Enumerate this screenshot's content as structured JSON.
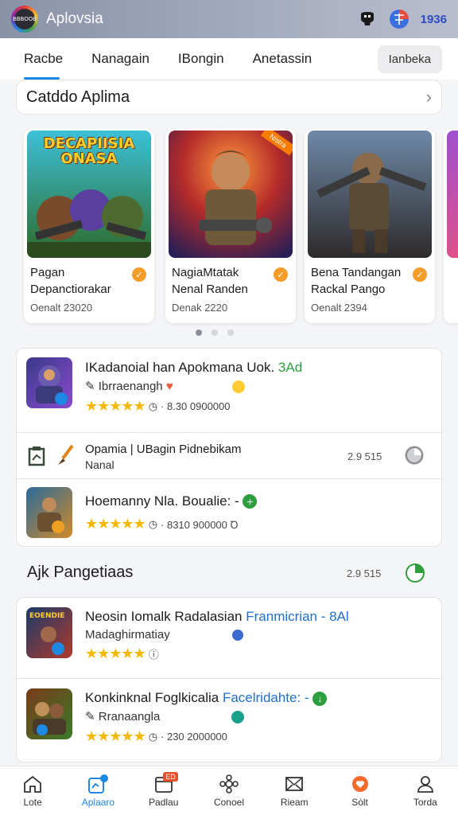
{
  "header": {
    "app_title": "Aplovsia",
    "logo_text": "BBBOOB",
    "right_text": "1936"
  },
  "tabs": [
    {
      "label": "Racbe"
    },
    {
      "label": "Nanagain"
    },
    {
      "label": "IBongin"
    },
    {
      "label": "Anetassin"
    }
  ],
  "tab_button": "Ianbeka",
  "category": {
    "title": "Catddo Aplima"
  },
  "carousel": [
    {
      "art_text": "DECAPIISIA ONASA",
      "line1": "Pagan",
      "line2": "Depanctiorakar",
      "date": "Oenalt 23020",
      "ribbon": ""
    },
    {
      "art_text": "",
      "line1": "NagiaMtatak",
      "line2": "Nenal Randen",
      "date": "Denak 2220",
      "ribbon": "Nistra"
    },
    {
      "art_text": "",
      "line1": "Bena Tandangan",
      "line2": "Rackal Pango",
      "date": "Oenalt 2394",
      "ribbon": ""
    }
  ],
  "list1": [
    {
      "title": "IKadanoial han Apokmana Uok.",
      "title_tag": "3Ad",
      "sub": "Ibrraenangh",
      "meta": "· 8.30 0900000"
    },
    {
      "title": "Opamia | UBagin Pidnebikam",
      "sub": "Nanal",
      "right": "2.9 515"
    },
    {
      "title": "Hoemanny  Nla. Boualie: -",
      "meta": "· 8310 900000 Ꝺ"
    }
  ],
  "section": {
    "title": "Ajk Pangetiaas",
    "count": "2.9 515"
  },
  "list2": [
    {
      "title": "Neosin Iomalk Radalasian",
      "title_tag": "Franmicrian - 8Al",
      "sub": "Madaghirmatiay",
      "icon_label": "EOENDIE"
    },
    {
      "title": "Konkinknal Foglkicalia",
      "title_tag": "Facelridahte: -",
      "sub": "Rranaangla",
      "meta": "· 230 2000000"
    }
  ],
  "bottom_nav": [
    {
      "label": "Lote",
      "icon": "home-icon"
    },
    {
      "label": "Aplaaro",
      "icon": "apps-icon",
      "active": true
    },
    {
      "label": "Padlau",
      "icon": "calendar-icon",
      "badge": "ED"
    },
    {
      "label": "Conoel",
      "icon": "network-icon"
    },
    {
      "label": "Rieam",
      "icon": "mail-icon"
    },
    {
      "label": "Sòlt",
      "icon": "heart-icon"
    },
    {
      "label": "Torda",
      "icon": "user-icon"
    }
  ],
  "colors": {
    "accent": "#1e88e5",
    "star": "#f5b800",
    "badge": "#f59d2a",
    "green": "#2e9e3e"
  }
}
